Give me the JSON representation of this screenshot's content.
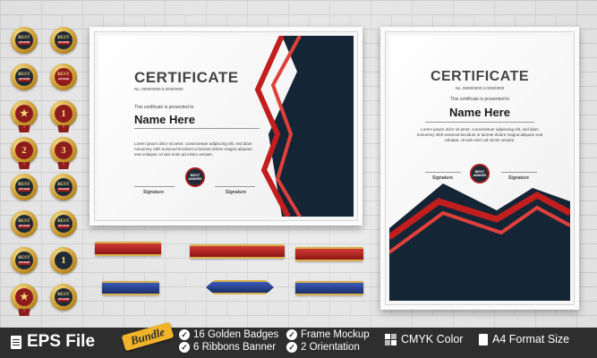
{
  "certificate_left": {
    "title": "CERTIFICATE",
    "number": "No. 0000/0000.0.0/00/0000",
    "presented": "This certificate is presented to",
    "name": "Name Here",
    "body": "Lorem ipsum dolor sit amet, consectetuer adipiscing elit, sed diam nonummy nibh euismod tincidunt ut laoreet dolore magna aliquam erat volutpat. Ut wisi enim ad minim veniam.",
    "sig1": "Signature",
    "sig2": "Signature",
    "seal_top": "BEST",
    "seal_bottom": "AWARD"
  },
  "certificate_right": {
    "title": "CERTIFICATE",
    "number": "No. 0000/0000.0.0/00/0000",
    "presented": "This certificate is presented to",
    "name": "Name Here",
    "body": "Lorem ipsum dolor sit amet, consectetuer adipiscing elit, sed diam nonummy nibh euismod tincidunt ut laoreet dolore magna aliquam erat volutpat. Ut wisi enim ad minim veniam.",
    "sig1": "Signature",
    "sig2": "Signature",
    "seal_top": "BEST",
    "seal_bottom": "AWARD"
  },
  "badges": [
    {
      "type": "text",
      "t1": "BEST",
      "t2": "AWARD",
      "bg": "dark"
    },
    {
      "type": "text",
      "t1": "BEST",
      "t2": "AWARD",
      "bg": "dark"
    },
    {
      "type": "text",
      "t1": "BEST",
      "t2": "AWARD",
      "bg": "dark"
    },
    {
      "type": "text",
      "t1": "BEST",
      "t2": "AWARD",
      "bg": "red"
    },
    {
      "type": "star",
      "t1": "★",
      "bg": "red"
    },
    {
      "type": "num",
      "t1": "1",
      "bg": "red"
    },
    {
      "type": "num",
      "t1": "2",
      "bg": "red"
    },
    {
      "type": "num",
      "t1": "3",
      "bg": "red"
    },
    {
      "type": "text",
      "t1": "BEST",
      "t2": "AWARD",
      "bg": "dark"
    },
    {
      "type": "text",
      "t1": "BEST",
      "t2": "AWARD",
      "bg": "dark"
    },
    {
      "type": "text",
      "t1": "BEST",
      "t2": "AWARD",
      "bg": "dark"
    },
    {
      "type": "text",
      "t1": "BEST",
      "t2": "AWARD",
      "bg": "dark"
    },
    {
      "type": "text",
      "t1": "BEST",
      "t2": "AWARD",
      "bg": "dark"
    },
    {
      "type": "num",
      "t1": "1",
      "bg": "dark"
    },
    {
      "type": "star",
      "t1": "★",
      "bg": "red"
    },
    {
      "type": "text",
      "t1": "BEST",
      "t2": "AWARD",
      "bg": "dark"
    }
  ],
  "footer": {
    "eps_label": "EPS File",
    "bundle_label": "Bundle",
    "feature1": "16 Golden Badges",
    "feature2": "6  Ribbons Banner",
    "feature3": "Frame Mockup",
    "feature4": "2 Orientation",
    "cmyk_label": "CMYK Color",
    "a4_label": "A4 Format Size"
  },
  "colors": {
    "navy": "#142536",
    "red": "#c21e1e",
    "gold": "#d4a532",
    "bar": "#2e2e2e",
    "bundle": "#f0b429"
  }
}
